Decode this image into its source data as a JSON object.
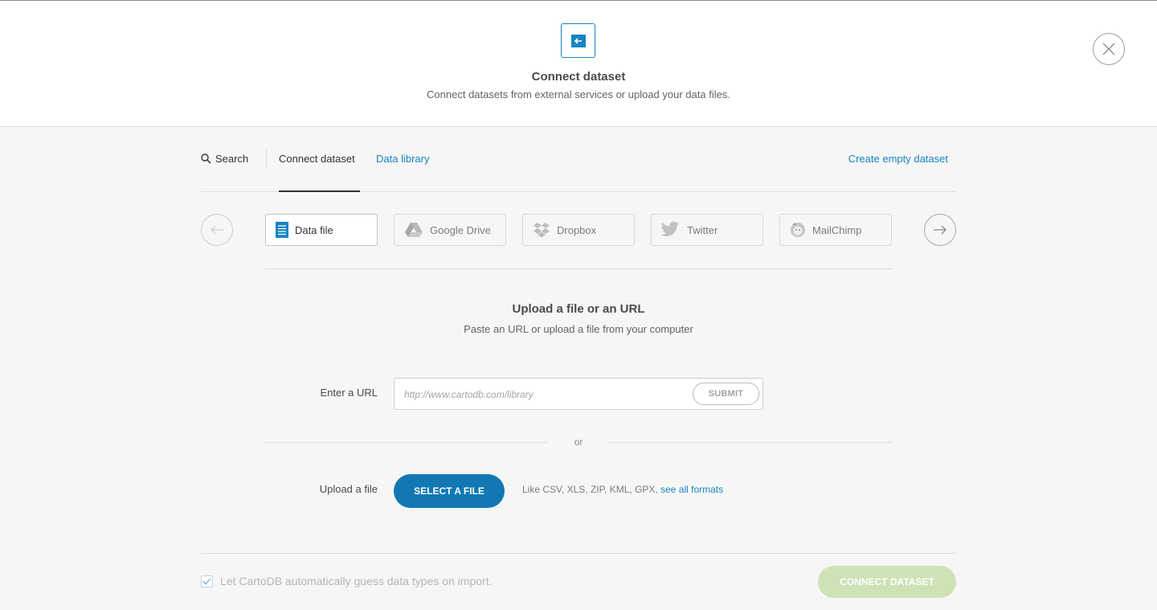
{
  "header": {
    "icon": "import-arrow-icon",
    "title": "Connect dataset",
    "subtitle": "Connect datasets from external services or upload your data files."
  },
  "nav": {
    "search_label": "Search",
    "connect_label": "Connect dataset",
    "library_label": "Data library",
    "create_label": "Create empty dataset"
  },
  "services": [
    {
      "label": "Data file",
      "icon": "document-icon",
      "active": true
    },
    {
      "label": "Google Drive",
      "icon": "google-drive-icon",
      "active": false
    },
    {
      "label": "Dropbox",
      "icon": "dropbox-icon",
      "active": false
    },
    {
      "label": "Twitter",
      "icon": "twitter-icon",
      "active": false
    },
    {
      "label": "MailChimp",
      "icon": "mailchimp-icon",
      "active": false
    }
  ],
  "upload": {
    "title": "Upload a file or an URL",
    "subtitle": "Paste an URL or upload a file from your computer",
    "url_label": "Enter a URL",
    "url_placeholder": "http://www.cartodb.com/library",
    "submit_label": "SUBMIT",
    "or_label": "or",
    "file_label": "Upload a file",
    "select_label": "SELECT A FILE",
    "formats_text": "Like CSV, XLS, ZIP, KML, GPX,",
    "formats_link": "see all formats"
  },
  "footer": {
    "guess_types_label": "Let CartoDB automatically guess data types on import.",
    "guess_types_checked": true,
    "connect_label": "CONNECT DATASET"
  },
  "colors": {
    "accent": "#1785c1",
    "primary_button": "#1178b4",
    "disabled_green": "#cfe2b6"
  }
}
